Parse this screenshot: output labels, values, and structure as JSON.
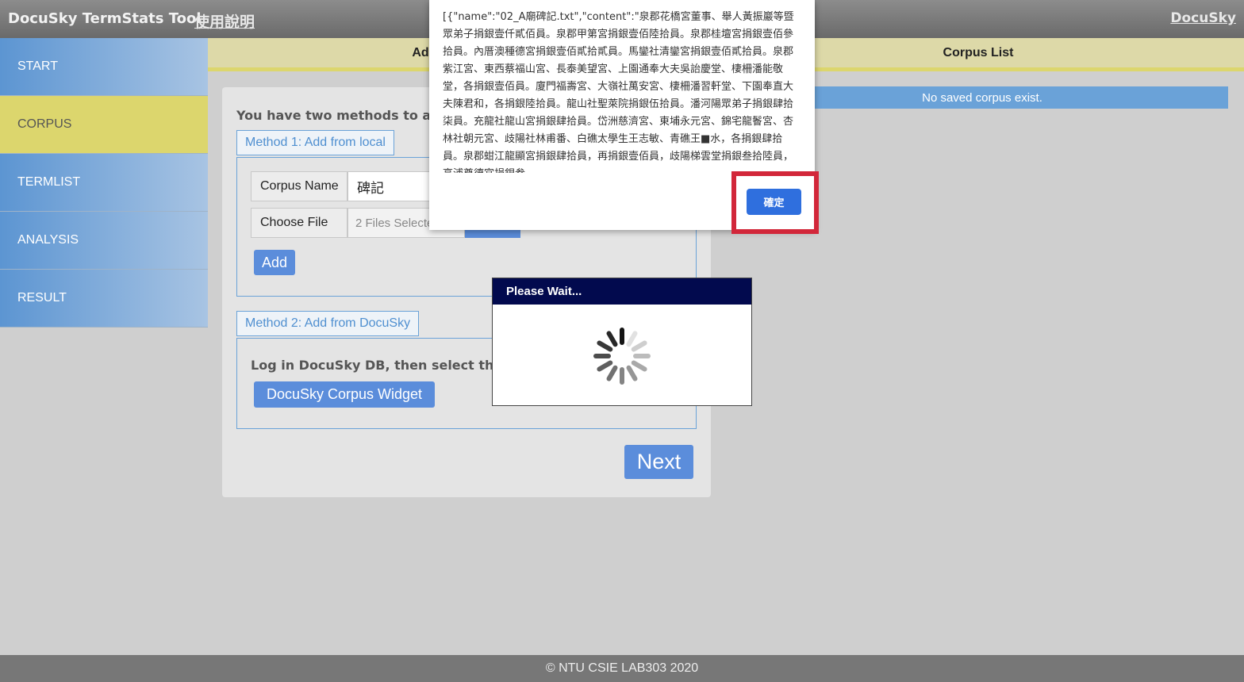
{
  "topbar": {
    "title": "DocuSky TermStats Tool",
    "help": "使用說明",
    "brand": "DocuSky"
  },
  "sidebar": {
    "items": [
      {
        "label": "START",
        "active": false
      },
      {
        "label": "CORPUS",
        "active": true
      },
      {
        "label": "TERMLIST",
        "active": false
      },
      {
        "label": "ANALYSIS",
        "active": false
      },
      {
        "label": "RESULT",
        "active": false
      }
    ]
  },
  "left_header": "Ad",
  "corpus_list": {
    "title": "Corpus List",
    "empty_message": "No saved corpus exist."
  },
  "main": {
    "intro": "You have two methods to add",
    "method1": {
      "legend": "Method 1: Add from local",
      "corpus_name_label": "Corpus Name",
      "corpus_name_value": "碑記",
      "choose_file_label": "Choose File",
      "file_status": "2 Files Selecte",
      "add_label": "Add"
    },
    "method2": {
      "legend": "Method 2: Add from DocuSky",
      "login_text": "Log in DocuSky DB, then select the co",
      "widget_label": "DocuSky Corpus Widget"
    },
    "next_label": "Next"
  },
  "alert": {
    "text": "[{\"name\":\"02_A廟碑記.txt\",\"content\":\"泉郡花橋宮董事、舉人黃振巖等暨眾弟子捐銀壹仟貳佰員。泉郡甲第宮捐銀壹佰陸拾員。泉郡桂壇宮捐銀壹佰參拾員。內厝澳種德宮捐銀壹佰貳拾貳員。馬鑾社清鑾宮捐銀壹佰貳拾員。泉郡紫江宮、東西蔡福山宮、長泰美望宮、上園通奉大夫吳詒慶堂、棲柵潘能敬堂，各捐銀壹佰員。廈門福壽宮、大嶺社萬安宮、棲柵潘習軒堂、下園奉直大夫陳君和，各捐銀陸拾員。龍山社聖萊院捐銀伍拾員。潘河陽眾弟子捐銀肆拾柒員。充龍社龍山宮捐銀肆拾員。岱洲慈濟宮、東埔永元宮、錦宅龍鬠宮、杏林社朝元宮、歧陽社林甫番、白礁太學生王志敏、青礁王■水，各捐銀肆拾員。泉郡蚶江龍顯宮捐銀肆拾員，再捐銀壹佰員，歧陽梯雲堂捐銀叁拾陸員，高浦尊德宮捐銀叁",
    "ok_label": "確定"
  },
  "wait_dialog": {
    "title": "Please Wait..."
  },
  "footer": "© NTU CSIE LAB303 2020",
  "colors": {
    "accent_blue": "#5b8ddb",
    "active_yellow": "#dcd66d",
    "highlight_red": "#d2273a",
    "dialog_navy": "#020a4e"
  }
}
